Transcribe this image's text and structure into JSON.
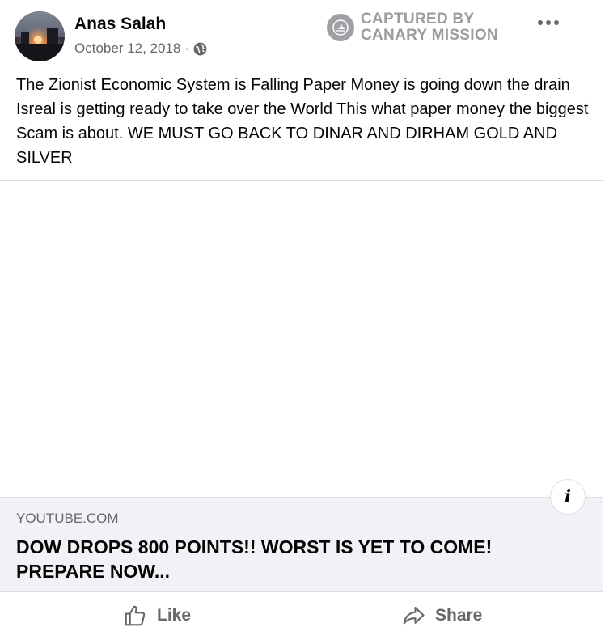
{
  "post": {
    "author": "Anas Salah",
    "date": "October 12, 2018",
    "date_separator": "·",
    "privacy_icon": "globe-icon",
    "text": "The Zionist Economic System is Falling Paper Money is going down the drain Isreal is getting ready to take over the World This what paper money the biggest Scam is about. WE MUST GO BACK TO DINAR AND DIRHAM GOLD AND SILVER"
  },
  "watermark": {
    "line1": "CAPTURED BY",
    "line2": "CANARY MISSION",
    "icon": "canary-mission-logo"
  },
  "link": {
    "domain": "YOUTUBE.COM",
    "title": "DOW DROPS 800 POINTS!! WORST IS YET TO COME! PREPARE NOW...",
    "info_label": "i"
  },
  "actions": {
    "like_label": "Like",
    "share_label": "Share"
  },
  "colors": {
    "secondary_text": "#65676b",
    "link_bg": "#f0f2f5",
    "divider": "#dcdee2"
  }
}
